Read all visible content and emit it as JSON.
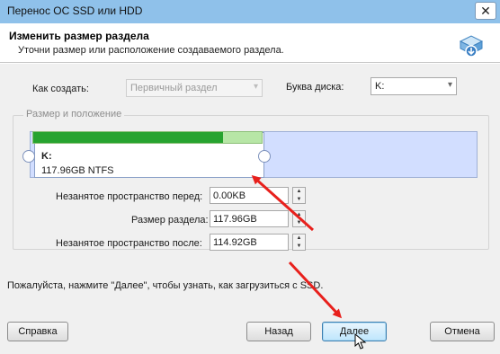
{
  "window": {
    "title": "Перенос ОС SSD или HDD",
    "close_glyph": "✕"
  },
  "header": {
    "title": "Изменить размер раздела",
    "subtitle": "Уточни размер или расположение создаваемого раздела.",
    "icon": "disk-migration-icon"
  },
  "form": {
    "create_as_label": "Как создать:",
    "create_as_value": "Первичный раздел",
    "drive_letter_label": "Буква диска:",
    "drive_letter_value": "K:"
  },
  "group": {
    "legend": "Размер и положение",
    "partition": {
      "letter": "K:",
      "info": "117.96GB NTFS",
      "used_fraction": 0.83
    },
    "fields": [
      {
        "label": "Незанятое пространство перед:",
        "value": "0.00KB"
      },
      {
        "label": "Размер раздела:",
        "value": "117.96GB"
      },
      {
        "label": "Незанятое пространство после:",
        "value": "114.92GB"
      }
    ]
  },
  "hint": "Пожалуйста, нажмите \"Далее\", чтобы узнать, как загрузиться с SSD.",
  "buttons": {
    "help": "Справка",
    "back": "Назад",
    "next": "Далее",
    "cancel": "Отмена"
  },
  "colors": {
    "titlebar": "#8fc1ea",
    "bar_fill": "#27a32f",
    "bar_empty": "#b7e6a6",
    "map_bg": "#d2deff",
    "annotation_arrow": "#e8201c"
  }
}
